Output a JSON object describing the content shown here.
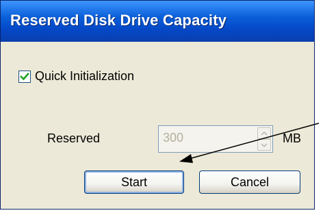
{
  "window": {
    "title": "Reserved Disk Drive Capacity"
  },
  "options": {
    "quick_init_label": "Quick Initialization",
    "quick_init_checked": true
  },
  "reserved": {
    "label": "Reserved",
    "value": "300",
    "unit": "MB",
    "enabled": false
  },
  "buttons": {
    "start_label": "Start",
    "cancel_label": "Cancel"
  },
  "icons": {
    "check": "check-icon",
    "spin_up": "chevron-up-icon",
    "spin_down": "chevron-down-icon",
    "annotation": "arrow-icon"
  },
  "colors": {
    "titlebar": "#0548c7",
    "window_bg": "#ece9d8",
    "checkmark": "#21a121",
    "disabled_text": "#b3b09c"
  }
}
